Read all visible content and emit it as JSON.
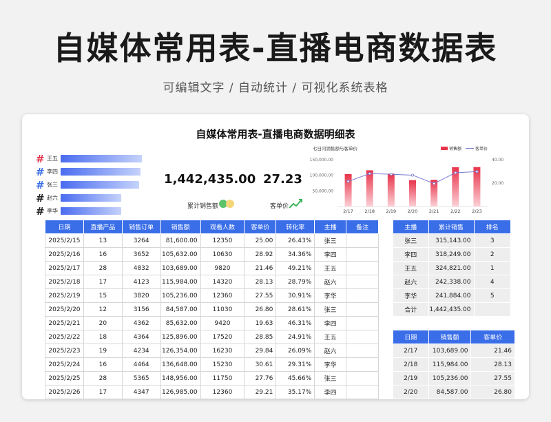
{
  "header": {
    "title": "自媒体常用表-直播电商数据表",
    "subtitle": "可编辑文字 / 自动统计 / 可视化系统表格"
  },
  "sheet": {
    "title": "自媒体常用表-直播电商数据明细表"
  },
  "hosts_bars": [
    {
      "hash": "#",
      "hash_color": "#e0334a",
      "name": "王五",
      "value": 324821
    },
    {
      "hash": "#",
      "hash_color": "#3a6ee8",
      "name": "李四",
      "value": 318249
    },
    {
      "hash": "#",
      "hash_color": "#3a6ee8",
      "name": "张三",
      "value": 315143
    },
    {
      "hash": "#",
      "hash_color": "#222222",
      "name": "赵六",
      "value": 242338
    },
    {
      "hash": "#",
      "hash_color": "#222222",
      "name": "李华",
      "value": 241884
    }
  ],
  "stats": {
    "total_sales": "1,442,435.00",
    "total_sales_label": "累计销售额",
    "avg_price": "27.23",
    "avg_price_label": "客单价"
  },
  "chart_data": {
    "type": "bar",
    "title": "七日内销售额与客单价",
    "categories": [
      "2/17",
      "2/18",
      "2/19",
      "2/20",
      "2/21",
      "2/22",
      "2/23"
    ],
    "series": [
      {
        "name": "销售额",
        "type": "bar",
        "values": [
          103689,
          115984,
          105236,
          84587,
          85632,
          125896,
          126354
        ]
      },
      {
        "name": "客单价",
        "type": "line",
        "values": [
          21.46,
          28.13,
          27.55,
          26.8,
          19.63,
          28.85,
          29.84
        ]
      }
    ],
    "y_left_ticks": [
      "150,000.00",
      "100,000.00",
      "50,000.00"
    ],
    "y_right_ticks": [
      "40.00",
      "20.00"
    ],
    "ylim_left": [
      0,
      150000
    ],
    "ylim_right": [
      0,
      40
    ],
    "colors": {
      "bar": "#e8334a",
      "line": "#7a7ad0"
    }
  },
  "main_table": {
    "headers": [
      "日期",
      "直播产品",
      "销售订单",
      "销售额",
      "观看人数",
      "客单价",
      "转化率",
      "主播",
      "备注"
    ],
    "rows": [
      [
        "2025/2/15",
        "13",
        "3264",
        "81,600.00",
        "12350",
        "25.00",
        "26.43%",
        "张三",
        ""
      ],
      [
        "2025/2/16",
        "16",
        "3652",
        "105,632.00",
        "10630",
        "28.92",
        "34.36%",
        "李四",
        ""
      ],
      [
        "2025/2/17",
        "28",
        "4832",
        "103,689.00",
        "9820",
        "21.46",
        "49.21%",
        "王五",
        ""
      ],
      [
        "2025/2/18",
        "17",
        "4123",
        "115,984.00",
        "14320",
        "28.13",
        "28.79%",
        "赵六",
        ""
      ],
      [
        "2025/2/19",
        "15",
        "3820",
        "105,236.00",
        "12360",
        "27.55",
        "30.91%",
        "李华",
        ""
      ],
      [
        "2025/2/20",
        "12",
        "3156",
        "84,587.00",
        "11030",
        "26.80",
        "28.61%",
        "张三",
        ""
      ],
      [
        "2025/2/21",
        "20",
        "4362",
        "85,632.00",
        "9420",
        "19.63",
        "46.31%",
        "李四",
        ""
      ],
      [
        "2025/2/22",
        "18",
        "4364",
        "125,896.00",
        "17520",
        "28.85",
        "24.91%",
        "王五",
        ""
      ],
      [
        "2025/2/23",
        "19",
        "4234",
        "126,354.00",
        "16230",
        "29.84",
        "26.09%",
        "赵六",
        ""
      ],
      [
        "2025/2/24",
        "16",
        "4464",
        "136,648.00",
        "15230",
        "30.61",
        "29.31%",
        "李华",
        ""
      ],
      [
        "2025/2/25",
        "28",
        "5365",
        "148,956.00",
        "11750",
        "27.76",
        "45.66%",
        "张三",
        ""
      ],
      [
        "2025/2/26",
        "17",
        "4347",
        "126,985.00",
        "12360",
        "29.21",
        "35.17%",
        "李四",
        ""
      ]
    ]
  },
  "rank_table": {
    "headers": [
      "主播",
      "累计销售",
      "排名"
    ],
    "rows": [
      [
        "张三",
        "315,143.00",
        "3"
      ],
      [
        "李四",
        "318,249.00",
        "2"
      ],
      [
        "王五",
        "324,821.00",
        "1"
      ],
      [
        "赵六",
        "242,338.00",
        "4"
      ],
      [
        "李华",
        "241,884.00",
        "5"
      ],
      [
        "合计",
        "1,442,435.00",
        ""
      ]
    ]
  },
  "daily_table": {
    "headers": [
      "日期",
      "销售额",
      "客单价"
    ],
    "rows": [
      [
        "2/17",
        "103,689.00",
        "21.46"
      ],
      [
        "2/18",
        "115,984.00",
        "28.13"
      ],
      [
        "2/19",
        "105,236.00",
        "27.55"
      ],
      [
        "2/20",
        "84,587.00",
        "26.80"
      ]
    ]
  }
}
